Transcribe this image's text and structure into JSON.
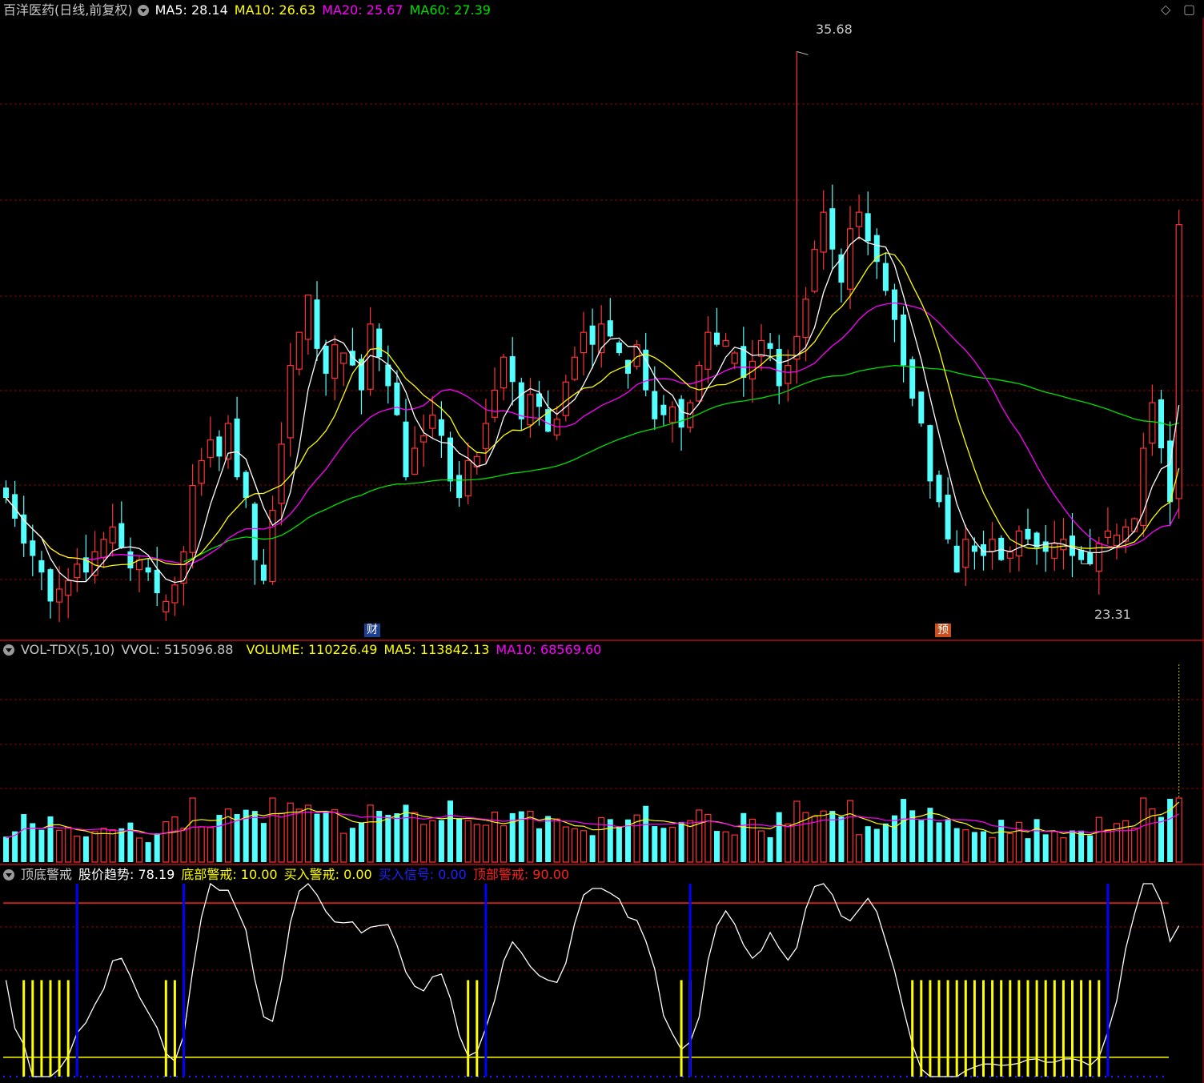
{
  "main_header": {
    "title": "百洋医药(日线,前复权)",
    "ma5_label": "MA5: 28.14",
    "ma10_label": "MA10: 26.63",
    "ma20_label": "MA20: 25.67",
    "ma60_label": "MA60: 27.39"
  },
  "annotations": {
    "high": "35.68",
    "low": "23.31",
    "badge_cai": "财",
    "badge_yu": "预"
  },
  "vol_header": {
    "title": "VOL-TDX(5,10)",
    "vvol": "VVOL: 515096.88",
    "volume": "VOLUME: 110226.49",
    "ma5": "MA5: 113842.13",
    "ma10": "MA10: 68569.60"
  },
  "ind_header": {
    "title": "顶底警戒",
    "trend": "股价趋势: 78.19",
    "bottom": "底部警戒: 10.00",
    "buy_warn": "买入警戒: 0.00",
    "buy_signal": "买入信号: 0.00",
    "top": "顶部警戒: 90.00"
  },
  "colors": {
    "up": "#ff3232",
    "down": "#54ffff",
    "ma5": "#ffffff",
    "ma10": "#ffff00",
    "ma20": "#ff00ff",
    "ma60": "#00e000",
    "grid": "#8b0000",
    "bottom_bar": "#ffff00",
    "signal": "#0000ff"
  },
  "icons": [
    "dropdown-circle-icon",
    "diamond-icon",
    "expand-square-icon"
  ],
  "chart_data": {
    "type": "candlestick",
    "price_range": [
      21.5,
      36.5
    ],
    "closes": [
      24.9,
      24.4,
      23.8,
      23.5,
      23.1,
      22.4,
      22.7,
      22.9,
      23.3,
      23.1,
      23.6,
      23.9,
      24.2,
      23.7,
      23.2,
      23.4,
      23.1,
      22.6,
      22.4,
      22.8,
      23.6,
      25.2,
      25.8,
      26.3,
      25.9,
      26.7,
      25.4,
      24.9,
      23.4,
      22.9,
      24.6,
      26.2,
      28.1,
      28.9,
      29.8,
      28.5,
      27.9,
      28.6,
      28.4,
      28.1,
      27.5,
      29.1,
      28.3,
      27.6,
      26.9,
      25.4,
      26.1,
      26.4,
      26.9,
      26.4,
      25.3,
      24.9,
      25.8,
      25.9,
      26.7,
      27.5,
      28.3,
      27.7,
      26.8,
      27.4,
      27.1,
      26.5,
      26.8,
      27.7,
      28.3,
      28.9,
      28.6,
      29.1,
      28.8,
      28.4,
      27.9,
      28.6,
      27.5,
      26.8,
      26.9,
      27.1,
      26.6,
      27.2,
      28.1,
      28.9,
      28.6,
      28.7,
      28.4,
      27.8,
      28.2,
      28.7,
      28.5,
      27.6,
      28.1,
      28.8,
      29.7,
      30.9,
      31.8,
      30.9,
      30.1,
      31.4,
      31.8,
      31.1,
      30.6,
      29.9,
      29.2,
      28.1,
      27.3,
      26.7,
      25.3,
      24.8,
      23.9,
      23.1,
      23.9,
      23.6,
      23.5,
      23.9,
      23.4,
      23.6,
      24.1,
      23.9,
      23.7,
      23.6,
      23.8,
      23.9,
      23.5,
      23.4,
      23.3,
      23.8,
      24.1,
      24.0,
      24.2,
      24.4,
      26.1,
      27.2,
      26.1,
      24.8,
      31.5
    ],
    "ma_final": {
      "ma5": 28.14,
      "ma10": 26.63,
      "ma20": 25.67,
      "ma60": 27.39
    },
    "annotated_high": 35.68,
    "annotated_low": 23.31,
    "volume_last": 110226.49,
    "vvol": 515096.88,
    "volume_ma5": 113842.13,
    "volume_ma10": 68569.6,
    "indicator": {
      "range": [
        0,
        100
      ],
      "price_trend_last": 78.19,
      "bottom_warning": 10.0,
      "buy_warning": 0.0,
      "buy_signal": 0.0,
      "top_warning": 90.0
    }
  }
}
